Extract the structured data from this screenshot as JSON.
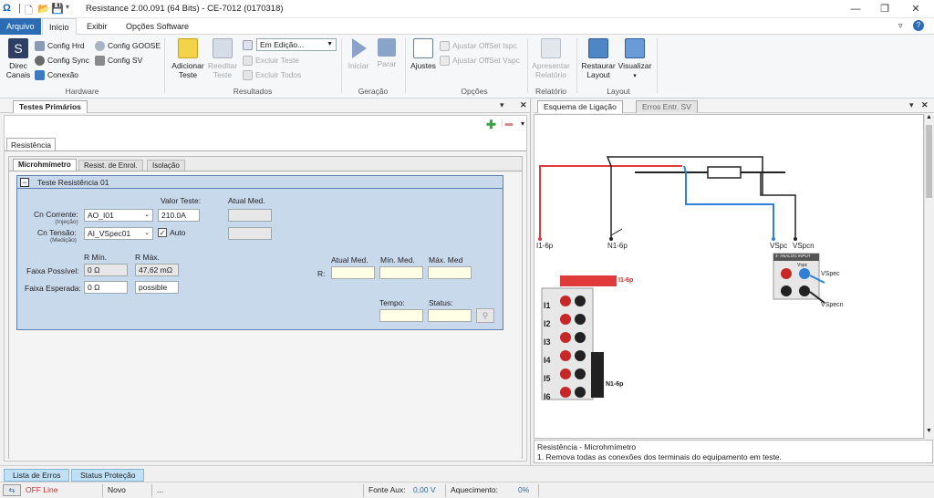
{
  "app": {
    "title": "Resistance 2.00.091 (64 Bits) - CE-7012 (0170318)"
  },
  "menu": {
    "file": "Arquivo",
    "home": "Início",
    "view": "Exibir",
    "options": "Opções Software"
  },
  "ribbon": {
    "direc_canais": "Direc\nCanais",
    "config_hrd": "Config Hrd",
    "config_sync": "Config Sync",
    "conexao": "Conexão",
    "config_goose": "Config GOOSE",
    "config_sv": "Config SV",
    "hardware": "Hardware",
    "adicionar_teste": "Adicionar\nTeste",
    "reeditar_teste": "Reeditar\nTeste",
    "edit_state": "Em Edição...",
    "excluir_teste": "Excluir Teste",
    "excluir_todos": "Excluir Todos",
    "resultados": "Resultados",
    "iniciar": "Iniciar",
    "parar": "Parar",
    "geracao": "Geração",
    "ajustes": "Ajustes",
    "ajustar_ispc": "Ajustar OffSet Ispc",
    "ajustar_vspc": "Ajustar OffSet Vspc",
    "opcoes": "Opções",
    "apresentar_relatorio": "Apresentar\nRelatório",
    "relatorio": "Relatório",
    "restaurar_layout": "Restaurar\nLayout",
    "visualizar": "Visualizar",
    "layout": "Layout"
  },
  "left_panel": {
    "tab": "Testes Primários",
    "subtab": "Resistência",
    "tabs": [
      "Microhmímetro",
      "Resist. de Enrol.",
      "Isolação"
    ],
    "group_title": "Teste Resistência 01",
    "lbl_valor_teste": "Valor Teste:",
    "lbl_atual_med": "Atual Med.",
    "lbl_cn_corrente": "Cn Corrente:",
    "lbl_injecao": "(Injeção)",
    "cn_corrente": "AO_I01",
    "valor_teste": "210.0A",
    "lbl_cn_tensao": "Cn Tensão:",
    "lbl_medicao": "(Medição)",
    "cn_tensao": "AI_VSpec01",
    "auto": "Auto",
    "lbl_rmin": "R Mín.",
    "lbl_rmax": "R Máx.",
    "lbl_faixa_possivel": "Faixa Possível:",
    "faixa_possivel_min": "0 Ω",
    "faixa_possivel_max": "47,62 mΩ",
    "lbl_faixa_esperada": "Faixa Esperada:",
    "faixa_esperada_min": "0 Ω",
    "faixa_esperada_max": "possible",
    "lbl_r": "R:",
    "lbl_atual": "Atual Med.",
    "lbl_min": "Mín. Med.",
    "lbl_max": "Máx. Med",
    "lbl_tempo": "Tempo:",
    "lbl_status": "Status:"
  },
  "right_panel": {
    "tabs": [
      "Esquema de Ligação",
      "Erros Entr. SV"
    ],
    "labels": {
      "i1": "I1-6p",
      "n1": "N1-6p",
      "vspc": "VSpc",
      "vspcn": "VSpcn",
      "i1b": "I1-6p",
      "n1b": "N1-6p",
      "vspec": "VSpec",
      "vspecn": "VSpecn",
      "analog": "3- ANALOG INPUT",
      "vspc_small": "Vspc"
    },
    "rows": [
      "I1",
      "I2",
      "I3",
      "I4",
      "I5",
      "I6"
    ],
    "info_title": "Resistência - Microhmímetro",
    "info_text": "1. Remova todas as conexões dos terminais do equipamento em teste."
  },
  "bottom_tabs": [
    "Lista de Erros",
    "Status Proteção"
  ],
  "status": {
    "offline": "OFF Line",
    "state": "Novo",
    "dots": "...",
    "fonte_aux_lbl": "Fonte Aux:",
    "fonte_aux": "0,00 V",
    "aquec_lbl": "Aquecimento:",
    "aquec": "0%"
  },
  "colors": {
    "accent": "#2b6cb5",
    "group_bg": "#c9d9ec",
    "wire_red": "#e03a3a",
    "wire_blue": "#2f7fd6"
  }
}
